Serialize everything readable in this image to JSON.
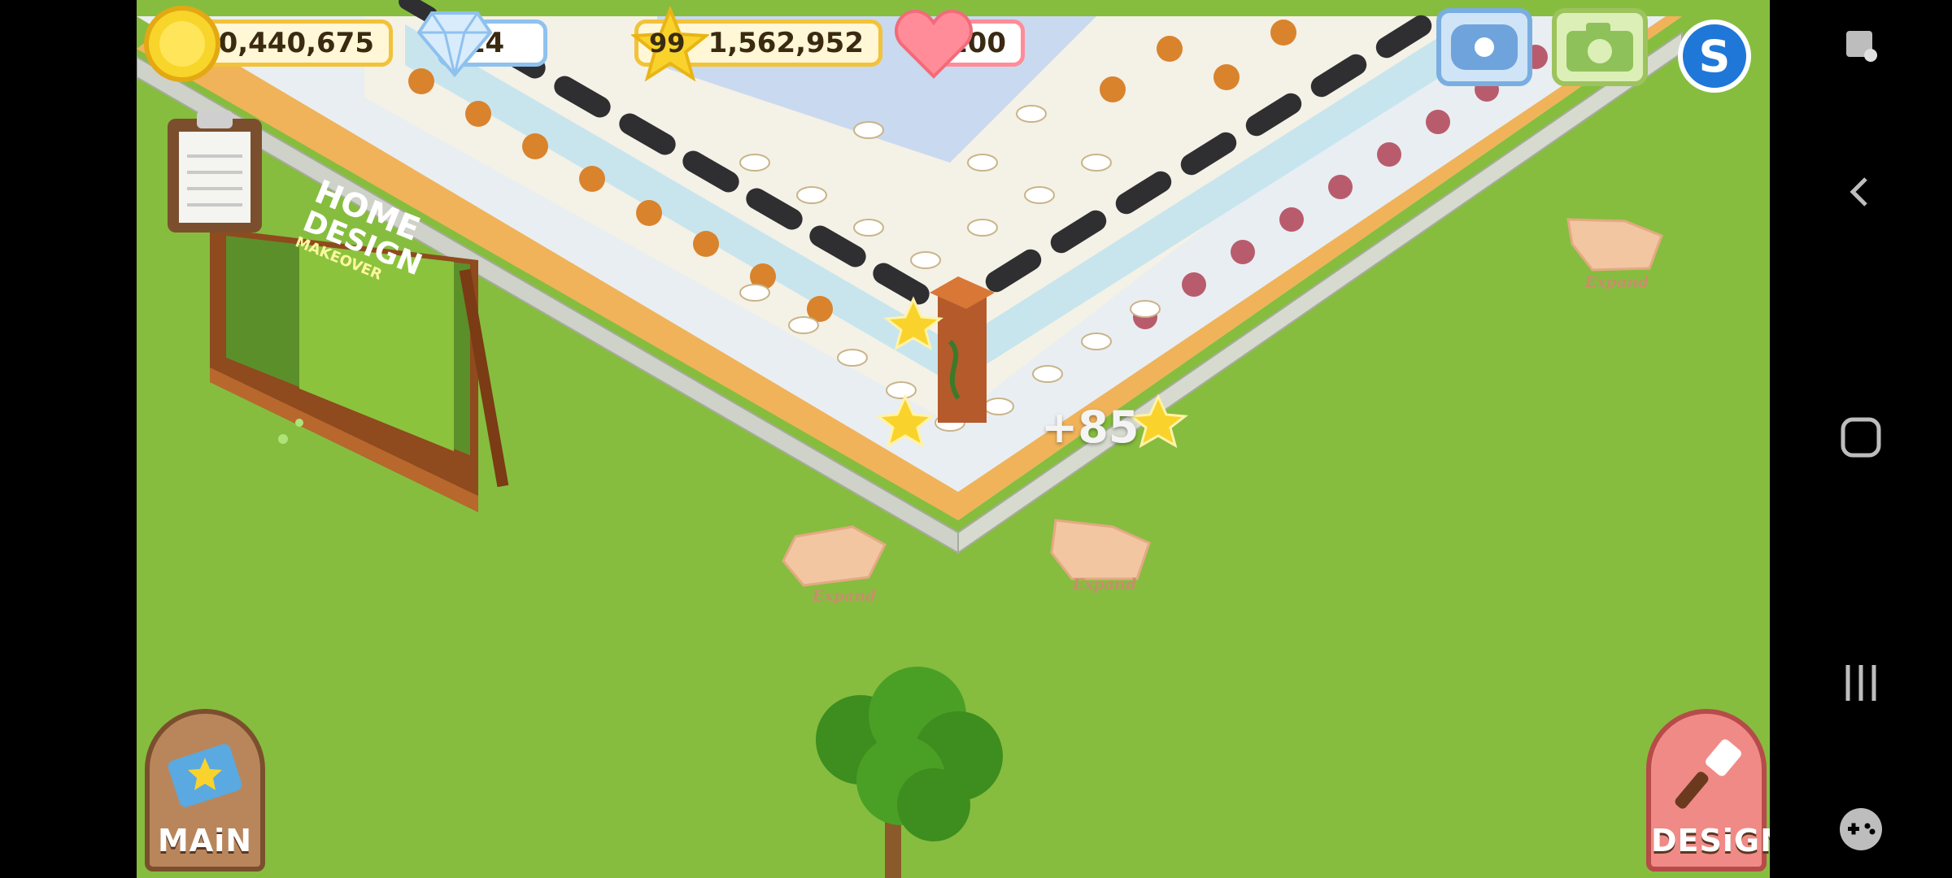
{
  "hud": {
    "coins": "40,440,675",
    "gems": "14",
    "level": "99",
    "experience": "1,562,952",
    "hearts": "100"
  },
  "buttons": {
    "main_label": "MAiN",
    "design_label": "DESiGN",
    "s_label": "S"
  },
  "billboard": {
    "brand_line1": "HOME",
    "brand_line2": "DESIGN",
    "brand_line3": "MAKEOVER"
  },
  "expand_arrows": [
    {
      "label": "Expand"
    },
    {
      "label": "Expand"
    },
    {
      "label": "Expand"
    }
  ],
  "floating_score": "+85",
  "colors": {
    "grass": "#86bd3f",
    "coin_border": "#f2c23a",
    "gem_border": "#8fc1ef",
    "heart_border": "#ff8c98",
    "main_button": "#b9865c",
    "design_button": "#f08a86"
  },
  "icons": [
    "coin-icon",
    "gem-icon",
    "star-icon",
    "heart-icon",
    "gamepad-phone-icon",
    "camera-icon",
    "s-icon",
    "clipboard-icon",
    "recipe-book-icon",
    "paintbrush-icon",
    "expand-arrow-icon",
    "back-icon",
    "home-icon",
    "recents-icon",
    "gamepad-icon",
    "screenshot-icon"
  ]
}
